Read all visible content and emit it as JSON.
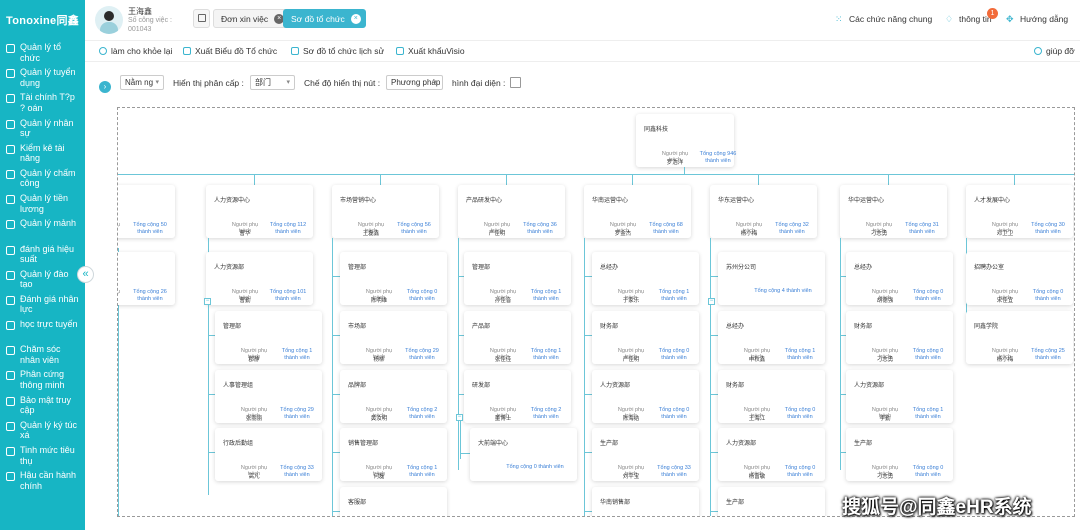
{
  "app": {
    "logo": "Tonoxine同鑫"
  },
  "sidebar": {
    "items": [
      {
        "label": "Quản lý tổ chức"
      },
      {
        "label": "Quản lý tuyển dụng"
      },
      {
        "label": "Tài chính T?p ? oán"
      },
      {
        "label": "Quản lý nhân sự"
      },
      {
        "label": "Kiểm kê tài năng"
      },
      {
        "label": "Quản lý chấm công"
      },
      {
        "label": "Quản lý tiền lương"
      },
      {
        "label": "Quản lý mảnh"
      },
      {
        "label": "đánh giá hiệu suất"
      },
      {
        "label": "Quản lý đào tạo"
      },
      {
        "label": "Đánh giá nhân lực"
      },
      {
        "label": "học trực tuyến"
      },
      {
        "label": "Chăm sóc nhân viên"
      },
      {
        "label": "Phân cứng thông minh"
      },
      {
        "label": "Bảo mật truy cập"
      },
      {
        "label": "Quản lý ký túc xá"
      },
      {
        "label": "Tinh mức tiêu thụ"
      },
      {
        "label": "Hậu cần hành chính"
      }
    ],
    "collapse_glyph": "«"
  },
  "header": {
    "user_name": "王海鑫",
    "user_sub": "Số công việc : 001043",
    "tabs": [
      {
        "label": "Đơn xin việc"
      },
      {
        "label": "Sơ đồ tổ chức"
      }
    ],
    "actions": {
      "features": "Các chức năng chung",
      "notify": "thông tin",
      "notify_count": "1",
      "guide": "Hướng dẫng"
    }
  },
  "toolbar": {
    "refresh": "làm cho khỏe lại",
    "export_chart": "Xuất Biểu đồ Tổ chức",
    "history": "Sơ đồ tổ chức lịch sử",
    "export_visio": "Xuất khẩuVisio",
    "help": "giúp đỡ"
  },
  "filters": {
    "year": "Nằm ng",
    "level_label": "Hiển thị phân cấp :",
    "level_value": "部门",
    "mode_label": "Chế độ hiển thị nút :",
    "mode_value": "Phương pháp",
    "avatar_label": "hình đại diện :"
  },
  "org": {
    "lead_label": "Người phụ trách",
    "root": {
      "name": "同鑫科技",
      "lead": "罗浩洋",
      "count": "Tổng cộng 946 thành viên"
    },
    "centers": [
      {
        "name": "",
        "lead": "",
        "count": "Tổng cộng 50 thành viên"
      },
      {
        "name": "人力资源中心",
        "lead": "曹华",
        "count": "Tổng cộng 112 thành viên"
      },
      {
        "name": "市场营销中心",
        "lead": "王磊鑫",
        "count": "Tổng cộng 56 thành viên"
      },
      {
        "name": "产品研发中心",
        "lead": "严佳明",
        "count": "Tổng cộng 36 thành viên"
      },
      {
        "name": "华南运营中心",
        "lead": "罗金杰",
        "count": "Tổng cộng 68 thành viên"
      },
      {
        "name": "华东运营中心",
        "lead": "杨小梅",
        "count": "Tổng cộng 32 thành viên"
      },
      {
        "name": "华中运营中心",
        "lead": "刁志勇",
        "count": "Tổng cộng 31 thành viên"
      },
      {
        "name": "人才发展中心",
        "lead": "邓卫卫",
        "count": "Tổng cộng 30 thành viên"
      }
    ],
    "sub_left": {
      "name": "",
      "lead": "",
      "count": "Tổng cộng 26 thành viên"
    },
    "col_hr": [
      {
        "name": "人力资源部",
        "lead": "曹勤",
        "count": "Tổng cộng 101 thành viên"
      },
      {
        "name": "管理部",
        "lead": "郡静",
        "count": "Tổng cộng 1 thành viên"
      },
      {
        "name": "人事管理组",
        "lead": "张丽丽",
        "count": "Tổng cộng 29 thành viên"
      },
      {
        "name": "行政后勤组",
        "lead": "高凡",
        "count": "Tổng cộng 33 thành viên"
      }
    ],
    "col_mkt": [
      {
        "name": "管理部",
        "lead": "陈明维",
        "count": "Tổng cộng 0 thành viên"
      },
      {
        "name": "市场部",
        "lead": "杨柳",
        "count": "Tổng cộng 29 thành viên"
      },
      {
        "name": "品牌部",
        "lead": "黄汝明",
        "count": "Tổng cộng 2 thành viên"
      },
      {
        "name": "销售管理部",
        "lead": "何磊",
        "count": "Tổng cộng 1 thành viên"
      },
      {
        "name": "客服部",
        "lead": "",
        "count": ""
      }
    ],
    "col_rd": [
      {
        "name": "管理部",
        "lead": "孙佳音",
        "count": "Tổng cộng 1 thành viên"
      },
      {
        "name": "产品部",
        "lead": "张佳佳",
        "count": "Tổng cộng 1 thành viên"
      },
      {
        "name": "研发部",
        "lead": "董博士",
        "count": "Tổng cộng 2 thành viên"
      },
      {
        "name": "大前端中心",
        "count": "Tổng cộng 0 thành viên"
      }
    ],
    "col_south": [
      {
        "name": "总经办",
        "lead": "于家乐",
        "count": "Tổng cộng 1 thành viên"
      },
      {
        "name": "财务部",
        "lead": "严佳明",
        "count": "Tổng cộng 0 thành viên"
      },
      {
        "name": "人力资源部",
        "lead": "陈海结",
        "count": "Tổng cộng 0 thành viên"
      },
      {
        "name": "生产部",
        "lead": "刘平宝",
        "count": "Tổng cộng 33 thành viên"
      },
      {
        "name": "华南销售部",
        "lead": "",
        "count": ""
      }
    ],
    "col_east": [
      {
        "name": "苏州分公司",
        "count": "Tổng cộng 4 thành viên"
      },
      {
        "name": "总经办",
        "lead": "申秋鑫",
        "count": "Tổng cộng 1 thành viên"
      },
      {
        "name": "财务部",
        "lead": "王海江",
        "count": "Tổng cộng 0 thành viên"
      },
      {
        "name": "人力资源部",
        "lead": "杨富敏",
        "count": "Tổng cộng 0 thành viên"
      },
      {
        "name": "生产部",
        "lead": "",
        "count": ""
      }
    ],
    "col_central": [
      {
        "name": "总经办",
        "lead": "胡德强",
        "count": "Tổng cộng 0 thành viên"
      },
      {
        "name": "财务部",
        "lead": "刁志勇",
        "count": "Tổng cộng 0 thành viên"
      },
      {
        "name": "人力资源部",
        "lead": "李勤",
        "count": "Tổng cộng 1 thành viên"
      },
      {
        "name": "生产部",
        "lead": "刁志勇",
        "count": "Tổng cộng 0 thành viên"
      }
    ],
    "col_talent": [
      {
        "name": "招聘办公室",
        "lead": "宋佳宜",
        "count": "Tổng cộng 0 thành viên"
      },
      {
        "name": "同鑫学院",
        "lead": "杨小梅",
        "count": "Tổng cộng 25 thành viên"
      }
    ]
  },
  "watermark": "搜狐号@同鑫eHR系统"
}
